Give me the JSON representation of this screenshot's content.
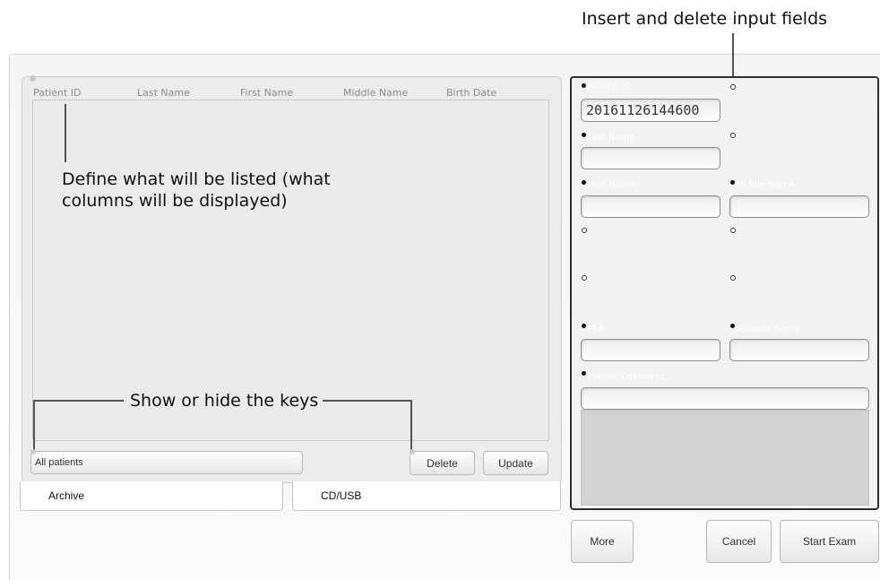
{
  "annotations": {
    "insert_delete_fields": "Insert and delete input fields",
    "define_columns_line1": "Define what will be listed (what",
    "define_columns_line2": "columns will be displayed)",
    "show_hide_keys": "Show or hide the keys"
  },
  "patient_list": {
    "columns": [
      "Patient ID",
      "Last Name",
      "First Name",
      "Middle Name",
      "Birth Date"
    ],
    "filter_value": "All patients",
    "delete_label": "Delete",
    "update_label": "Update"
  },
  "tabs": [
    "Archive",
    "CD/USB"
  ],
  "form": {
    "patient_id_label": "Patient ID",
    "patient_id_value": "20161126144600",
    "last_name_label": "Last Name",
    "first_name_label": "First Name",
    "middle_name_label": "Middle Name",
    "psa_label": "PSA",
    "gleason_label": "Gleason Score",
    "comment_label": "Patient Comment"
  },
  "footer": {
    "more_label": "More",
    "cancel_label": "Cancel",
    "start_exam_label": "Start Exam"
  }
}
